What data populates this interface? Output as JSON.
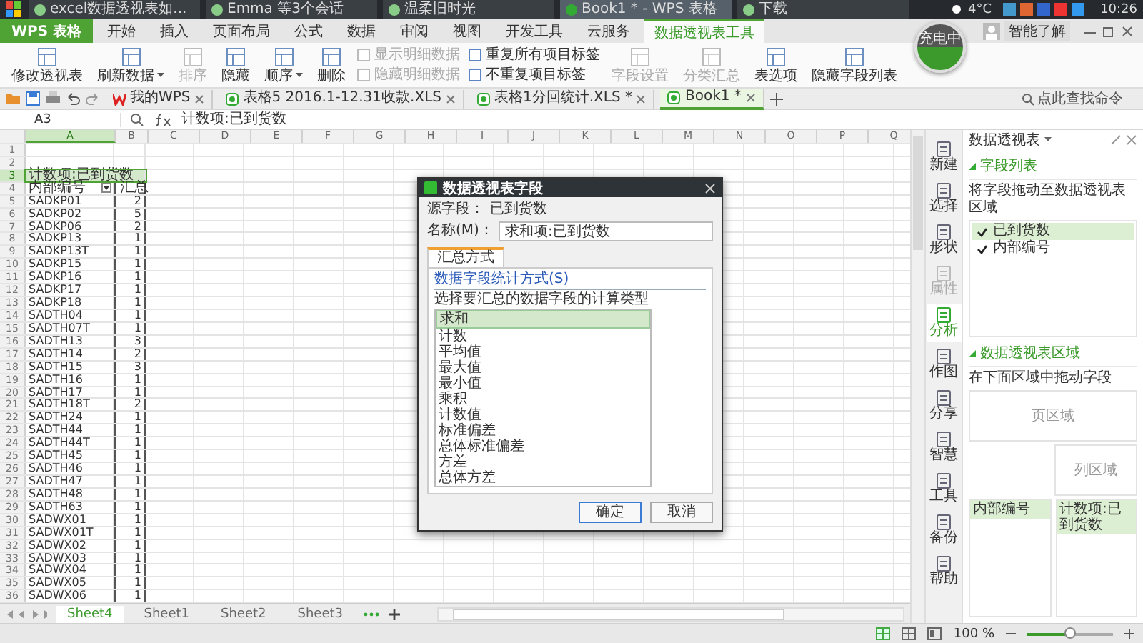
{
  "taskbar": {
    "items": [
      {
        "label": "excel数据透视表如...",
        "selected": false
      },
      {
        "label": "Emma 等3个会话",
        "selected": false
      },
      {
        "label": "温柔旧时光",
        "selected": false
      },
      {
        "label": "Book1 * - WPS 表格",
        "selected": true
      },
      {
        "label": "下载",
        "selected": false
      }
    ],
    "weather": "4°C",
    "clock": "10:26"
  },
  "app_button": "WPS 表格",
  "ribbon_tabs": [
    {
      "label": "开始",
      "selected": false
    },
    {
      "label": "插入",
      "selected": false
    },
    {
      "label": "页面布局",
      "selected": false
    },
    {
      "label": "公式",
      "selected": false
    },
    {
      "label": "数据",
      "selected": false
    },
    {
      "label": "审阅",
      "selected": false
    },
    {
      "label": "视图",
      "selected": false
    },
    {
      "label": "开发工具",
      "selected": false
    },
    {
      "label": "云服务",
      "selected": false
    },
    {
      "label": "数据透视表工具",
      "selected": true
    }
  ],
  "account": "智能了解",
  "ribbon": [
    {
      "kind": "large",
      "label": "修改透视表",
      "disabled": false,
      "dropdown": false
    },
    {
      "kind": "large",
      "label": "刷新数据",
      "disabled": false,
      "dropdown": true
    },
    {
      "kind": "large",
      "label": "排序",
      "disabled": true,
      "dropdown": false
    },
    {
      "kind": "large",
      "label": "隐藏",
      "disabled": false,
      "dropdown": false
    },
    {
      "kind": "large",
      "label": "顺序",
      "disabled": false,
      "dropdown": true
    },
    {
      "kind": "large",
      "label": "删除",
      "disabled": false,
      "dropdown": false
    },
    {
      "kind": "stack",
      "items": [
        {
          "label": "显示明细数据",
          "disabled": true
        },
        {
          "label": "隐藏明细数据",
          "disabled": true
        }
      ]
    },
    {
      "kind": "stack",
      "items": [
        {
          "label": "重复所有项目标签",
          "disabled": false
        },
        {
          "label": "不重复项目标签",
          "disabled": false
        }
      ]
    },
    {
      "kind": "large",
      "label": "字段设置",
      "disabled": true,
      "dropdown": false
    },
    {
      "kind": "large",
      "label": "分类汇总",
      "disabled": true,
      "dropdown": false
    },
    {
      "kind": "large",
      "label": "表选项",
      "disabled": false,
      "dropdown": false
    },
    {
      "kind": "large",
      "label": "隐藏字段列表",
      "disabled": false,
      "dropdown": false
    }
  ],
  "battery_widget": "充电中",
  "doc_tabs": [
    {
      "label": "我的WPS",
      "kind": "home",
      "selected": false
    },
    {
      "label": "表格5 2016.1-12.31收款.XLS",
      "kind": "sheet",
      "selected": false
    },
    {
      "label": "表格1分回统计.XLS *",
      "kind": "sheet",
      "selected": false
    },
    {
      "label": "Book1 *",
      "kind": "sheet",
      "selected": true
    }
  ],
  "command_search": {
    "placeholder": "点此查找命令"
  },
  "formula_bar": {
    "cell": "A3",
    "formula": "计数项:已到货数"
  },
  "sheet": {
    "columns": [
      {
        "label": "A",
        "selected": true
      },
      {
        "label": "B",
        "selected": false
      },
      {
        "label": "C",
        "selected": false
      },
      {
        "label": "D",
        "selected": false
      },
      {
        "label": "E",
        "selected": false
      },
      {
        "label": "F",
        "selected": false
      },
      {
        "label": "G",
        "selected": false
      },
      {
        "label": "H",
        "selected": false
      },
      {
        "label": "I",
        "selected": false
      },
      {
        "label": "J",
        "selected": false
      },
      {
        "label": "K",
        "selected": false
      },
      {
        "label": "L",
        "selected": false
      },
      {
        "label": "M",
        "selected": false
      },
      {
        "label": "N",
        "selected": false
      },
      {
        "label": "O",
        "selected": false
      },
      {
        "label": "P",
        "selected": false
      },
      {
        "label": "Q",
        "selected": false
      }
    ],
    "rows": [
      {
        "number": "1",
        "kind": "empty",
        "selected": false
      },
      {
        "number": "2",
        "kind": "empty",
        "selected": false
      },
      {
        "number": "3",
        "kind": "header",
        "a": "计数项:已到货数",
        "selected": true
      },
      {
        "number": "4",
        "kind": "field",
        "a": "内部编号",
        "b": "汇总",
        "selected": false
      },
      {
        "number": "5",
        "kind": "data",
        "a": "SADKP01",
        "b": "2",
        "selected": false
      },
      {
        "number": "6",
        "kind": "data",
        "a": "SADKP02",
        "b": "5",
        "selected": false
      },
      {
        "number": "7",
        "kind": "data",
        "a": "SADKP06",
        "b": "2",
        "selected": false
      },
      {
        "number": "8",
        "kind": "data",
        "a": "SADKP13",
        "b": "1",
        "selected": false
      },
      {
        "number": "9",
        "kind": "data",
        "a": "SADKP13T",
        "b": "1",
        "selected": false
      },
      {
        "number": "10",
        "kind": "data",
        "a": "SADKP15",
        "b": "1",
        "selected": false
      },
      {
        "number": "11",
        "kind": "data",
        "a": "SADKP16",
        "b": "1",
        "selected": false
      },
      {
        "number": "12",
        "kind": "data",
        "a": "SADKP17",
        "b": "1",
        "selected": false
      },
      {
        "number": "13",
        "kind": "data",
        "a": "SADKP18",
        "b": "1",
        "selected": false
      },
      {
        "number": "14",
        "kind": "data",
        "a": "SADTH04",
        "b": "1",
        "selected": false
      },
      {
        "number": "15",
        "kind": "data",
        "a": "SADTH07T",
        "b": "1",
        "selected": false
      },
      {
        "number": "16",
        "kind": "data",
        "a": "SADTH13",
        "b": "3",
        "selected": false
      },
      {
        "number": "17",
        "kind": "data",
        "a": "SADTH14",
        "b": "2",
        "selected": false
      },
      {
        "number": "18",
        "kind": "data",
        "a": "SADTH15",
        "b": "3",
        "selected": false
      },
      {
        "number": "19",
        "kind": "data",
        "a": "SADTH16",
        "b": "1",
        "selected": false
      },
      {
        "number": "20",
        "kind": "data",
        "a": "SADTH17",
        "b": "1",
        "selected": false
      },
      {
        "number": "21",
        "kind": "data",
        "a": "SADTH18T",
        "b": "2",
        "selected": false
      },
      {
        "number": "22",
        "kind": "data",
        "a": "SADTH24",
        "b": "1",
        "selected": false
      },
      {
        "number": "23",
        "kind": "data",
        "a": "SADTH44",
        "b": "1",
        "selected": false
      },
      {
        "number": "24",
        "kind": "data",
        "a": "SADTH44T",
        "b": "1",
        "selected": false
      },
      {
        "number": "25",
        "kind": "data",
        "a": "SADTH45",
        "b": "1",
        "selected": false
      },
      {
        "number": "26",
        "kind": "data",
        "a": "SADTH46",
        "b": "1",
        "selected": false
      },
      {
        "number": "27",
        "kind": "data",
        "a": "SADTH47",
        "b": "1",
        "selected": false
      },
      {
        "number": "28",
        "kind": "data",
        "a": "SADTH48",
        "b": "1",
        "selected": false
      },
      {
        "number": "29",
        "kind": "data",
        "a": "SADTH63",
        "b": "1",
        "selected": false
      },
      {
        "number": "30",
        "kind": "data",
        "a": "SADWX01",
        "b": "1",
        "selected": false
      },
      {
        "number": "31",
        "kind": "data",
        "a": "SADWX01T",
        "b": "1",
        "selected": false
      },
      {
        "number": "32",
        "kind": "data",
        "a": "SADWX02",
        "b": "1",
        "selected": false
      },
      {
        "number": "33",
        "kind": "data",
        "a": "SADWX03",
        "b": "1",
        "selected": false
      },
      {
        "number": "34",
        "kind": "data",
        "a": "SADWX04",
        "b": "1",
        "selected": false
      },
      {
        "number": "35",
        "kind": "data",
        "a": "SADWX05",
        "b": "1",
        "selected": false
      },
      {
        "number": "36",
        "kind": "data",
        "a": "SADWX06",
        "b": "1",
        "selected": false
      }
    ]
  },
  "sheet_tabs": [
    {
      "label": "Sheet4",
      "selected": true
    },
    {
      "label": "Sheet1",
      "selected": false
    },
    {
      "label": "Sheet2",
      "selected": false
    },
    {
      "label": "Sheet3",
      "selected": false
    }
  ],
  "side_icons": [
    {
      "label": "新建",
      "selected": false,
      "disabled": false
    },
    {
      "label": "选择",
      "selected": false,
      "disabled": false
    },
    {
      "label": "形状",
      "selected": false,
      "disabled": false
    },
    {
      "label": "属性",
      "selected": false,
      "disabled": true
    },
    {
      "label": "分析",
      "selected": true,
      "disabled": false
    },
    {
      "label": "作图",
      "selected": false,
      "disabled": false
    },
    {
      "label": "分享",
      "selected": false,
      "disabled": false
    },
    {
      "label": "智慧",
      "selected": false,
      "disabled": false
    },
    {
      "label": "工具",
      "selected": false,
      "disabled": false
    },
    {
      "label": "备份",
      "selected": false,
      "disabled": false
    },
    {
      "label": "帮助",
      "selected": false,
      "disabled": false
    }
  ],
  "pivot_panel": {
    "title": "数据透视表",
    "field_section": "字段列表",
    "field_hint": "将字段拖动至数据透视表区域",
    "fields": [
      {
        "label": "已到货数",
        "checked": true,
        "selected": true
      },
      {
        "label": "内部编号",
        "checked": true,
        "selected": false
      }
    ],
    "area_section": "数据透视表区域",
    "area_hint": "在下面区域中拖动字段",
    "page_area": "页区域",
    "column_area": "列区域",
    "row_fields": [
      "内部编号"
    ],
    "data_fields": [
      "计数项:已到货数"
    ]
  },
  "dialog": {
    "title": "数据透视表字段",
    "source_label": "源字段：",
    "source": "已到货数",
    "name_label": "名称(M)：",
    "name": "求和项:已到货数",
    "tab": "汇总方式",
    "group": "数据字段统计方式(S)",
    "hint": "选择要汇总的数据字段的计算类型",
    "functions": [
      {
        "label": "求和",
        "selected": true
      },
      {
        "label": "计数",
        "selected": false
      },
      {
        "label": "平均值",
        "selected": false
      },
      {
        "label": "最大值",
        "selected": false
      },
      {
        "label": "最小值",
        "selected": false
      },
      {
        "label": "乘积",
        "selected": false
      },
      {
        "label": "计数值",
        "selected": false
      },
      {
        "label": "标准偏差",
        "selected": false
      },
      {
        "label": "总体标准偏差",
        "selected": false
      },
      {
        "label": "方差",
        "selected": false
      },
      {
        "label": "总体方差",
        "selected": false
      }
    ],
    "buttons": [
      {
        "label": "确定",
        "kind": "default"
      },
      {
        "label": "取消",
        "kind": "normal"
      }
    ]
  },
  "status_bar": {
    "zoom": "100 %",
    "level": 0.5
  }
}
